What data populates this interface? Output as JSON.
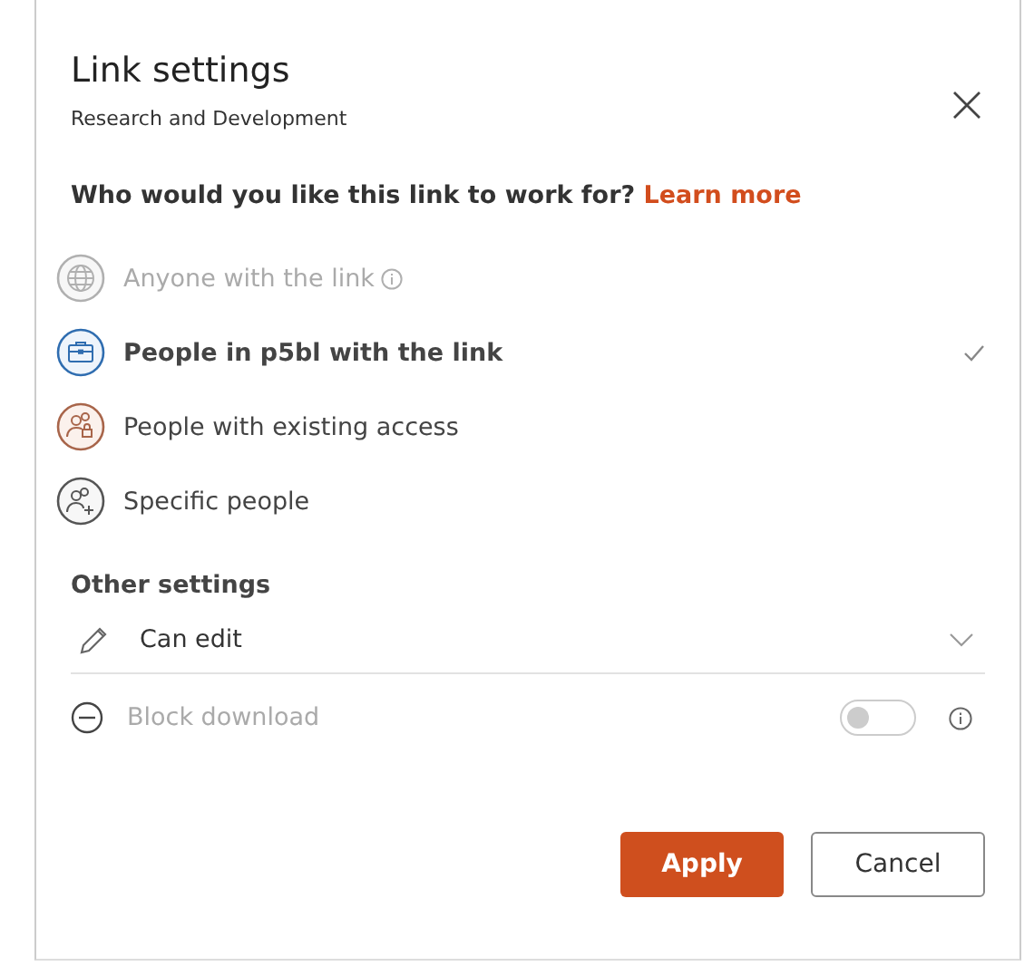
{
  "title": "Link settings",
  "subtitle": "Research and Development",
  "question": {
    "text": "Who would you like this link to work for?",
    "link": "Learn more"
  },
  "options": [
    {
      "kind": "globe",
      "label": "Anyone with the link",
      "info": true,
      "disabled": true,
      "selected": false
    },
    {
      "kind": "briefcase",
      "label": "People in p5bl with the link",
      "info": false,
      "disabled": false,
      "selected": true
    },
    {
      "kind": "lock-people",
      "label": "People with existing access",
      "info": false,
      "disabled": false,
      "selected": false
    },
    {
      "kind": "add-people",
      "label": "Specific people",
      "info": false,
      "disabled": false,
      "selected": false
    }
  ],
  "other_settings": {
    "heading": "Other settings",
    "permission": "Can edit",
    "block_download": {
      "label": "Block download",
      "disabled": true,
      "on": false
    }
  },
  "buttons": {
    "apply": "Apply",
    "cancel": "Cancel"
  }
}
